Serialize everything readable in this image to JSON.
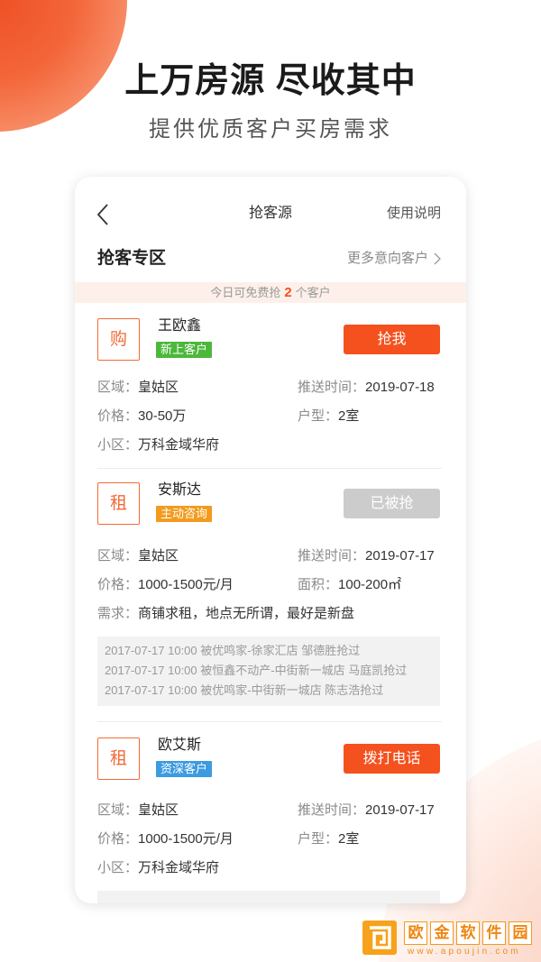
{
  "theme": {
    "accent": "#f4511e",
    "badge_color": "#f26a35",
    "banner_bg": "#fdf0ea"
  },
  "hero": {
    "title": "上万房源 尽收其中",
    "subtitle": "提供优质客户买房需求"
  },
  "nav": {
    "back_icon": "chevron-left-icon",
    "title": "抢客源",
    "help_label": "使用说明"
  },
  "zone": {
    "title": "抢客专区",
    "more_label": "更多意向客户",
    "more_icon": "chevron-right-icon"
  },
  "quota_banner": {
    "prefix": "今日可免费抢",
    "count": "2",
    "suffix": "个客户"
  },
  "customers": [
    {
      "type_badge": "购",
      "name": "王欧鑫",
      "tag": "新上客户",
      "tag_color": "#4cb83b",
      "action_label": "抢我",
      "action_color": "#f4511e",
      "rows": [
        [
          {
            "label": "区域：",
            "value": "皇姑区"
          },
          {
            "label": "推送时间：",
            "value": "2019-07-18"
          }
        ],
        [
          {
            "label": "价格：",
            "value": "30-50万"
          },
          {
            "label": "户型：",
            "value": "2室"
          }
        ],
        [
          {
            "label": "小区：",
            "value": "万科金域华府"
          }
        ]
      ]
    },
    {
      "type_badge": "租",
      "name": "安斯达",
      "tag": "主动咨询",
      "tag_color": "#f29b1d",
      "action_label": "已被抢",
      "action_color": "#cccccc",
      "rows": [
        [
          {
            "label": "区域：",
            "value": "皇姑区"
          },
          {
            "label": "推送时间：",
            "value": "2019-07-17"
          }
        ],
        [
          {
            "label": "价格：",
            "value": "1000-1500元/月"
          },
          {
            "label": "面积：",
            "value": "100-200㎡"
          }
        ],
        [
          {
            "label": "需求：",
            "value": "商铺求租，地点无所谓，最好是新盘"
          }
        ]
      ],
      "history": [
        "2017-07-17 10:00 被优鸣家-徐家汇店 邹德胜抢过",
        "2017-07-17 10:00 被恒鑫不动产-中街新一城店 马庭凯抢过",
        "2017-07-17 10:00 被优鸣家-中街新一城店 陈志浩抢过"
      ]
    },
    {
      "type_badge": "租",
      "name": "欧艾斯",
      "tag": "资深客户",
      "tag_color": "#3d9be0",
      "action_label": "拨打电话",
      "action_color": "#f4511e",
      "rows": [
        [
          {
            "label": "区域：",
            "value": "皇姑区"
          },
          {
            "label": "推送时间：",
            "value": "2019-07-17"
          }
        ],
        [
          {
            "label": "价格：",
            "value": "1000-1500元/月"
          },
          {
            "label": "户型：",
            "value": "2室"
          }
        ],
        [
          {
            "label": "小区：",
            "value": "万科金域华府"
          }
        ]
      ]
    }
  ],
  "watermark": {
    "icon": "site-logo-icon",
    "chars": [
      "欧",
      "金",
      "软",
      "件",
      "园"
    ],
    "url": "www.apoujin.com",
    "color": "#f39a1c"
  }
}
